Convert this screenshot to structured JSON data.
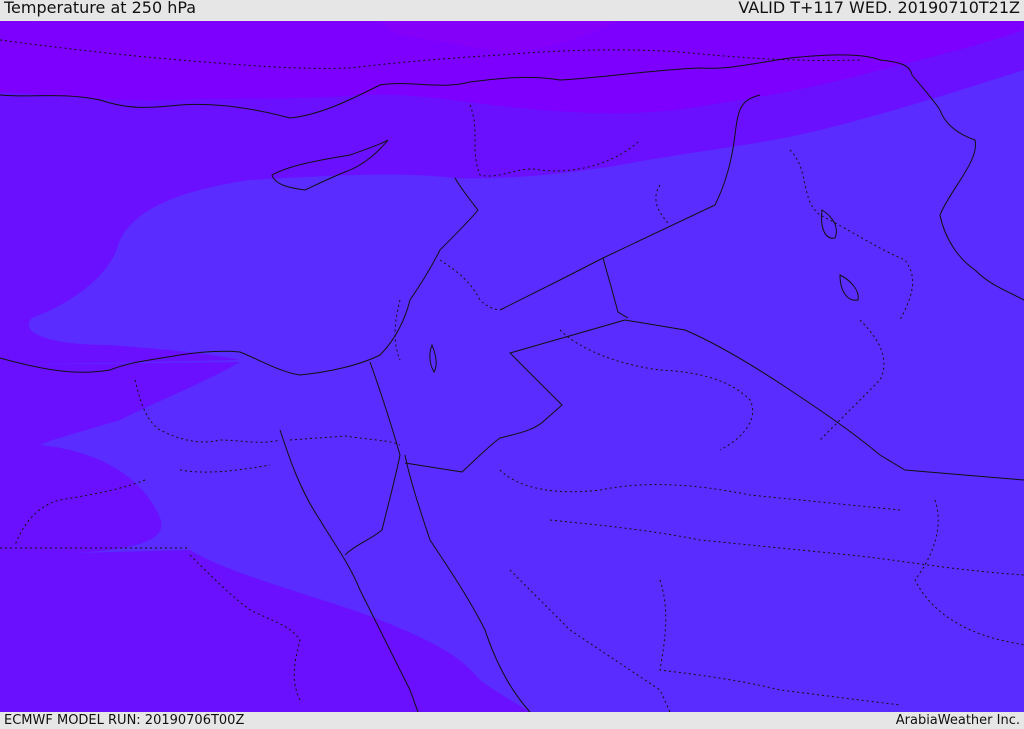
{
  "header": {
    "title": "Temperature at 250 hPa",
    "valid": "VALID T+117 WED. 20190710T21Z"
  },
  "footer": {
    "model_run": "ECMWF MODEL RUN: 20190706T00Z",
    "credit": "ArabiaWeather Inc."
  },
  "map": {
    "colors": {
      "band_cold": "#7d00ff",
      "band_mid": "#6a10ff",
      "band_warm": "#5a2cff",
      "border": "#111111"
    }
  }
}
